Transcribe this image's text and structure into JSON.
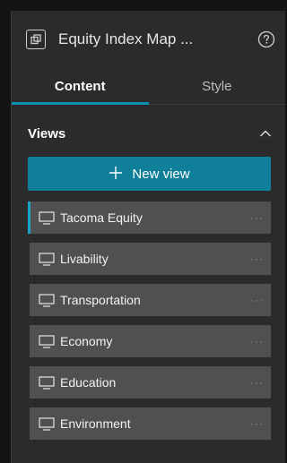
{
  "header": {
    "title": "Equity Index Map ..."
  },
  "tabs": [
    {
      "label": "Content",
      "active": true
    },
    {
      "label": "Style",
      "active": false
    }
  ],
  "section": {
    "title": "Views"
  },
  "new_view": {
    "label": "New view"
  },
  "views": [
    {
      "label": "Tacoma Equity",
      "selected": true,
      "more": "···"
    },
    {
      "label": "Livability",
      "selected": false,
      "more": "···"
    },
    {
      "label": "Transportation",
      "selected": false,
      "more": "···"
    },
    {
      "label": "Economy",
      "selected": false,
      "more": "···"
    },
    {
      "label": "Education",
      "selected": false,
      "more": "···"
    },
    {
      "label": "Environment",
      "selected": false,
      "more": "···"
    }
  ],
  "icons": {
    "app": "app-window-icon",
    "help": "question-circle-icon",
    "collapse": "chevron-up-icon",
    "add": "plus-icon",
    "view": "monitor-icon",
    "more": "ellipsis-icon"
  },
  "colors": {
    "accent": "#0f7f9a",
    "tab_indicator": "#0f8eb4",
    "panel_bg": "#2b2b2b",
    "item_bg": "#505050"
  }
}
